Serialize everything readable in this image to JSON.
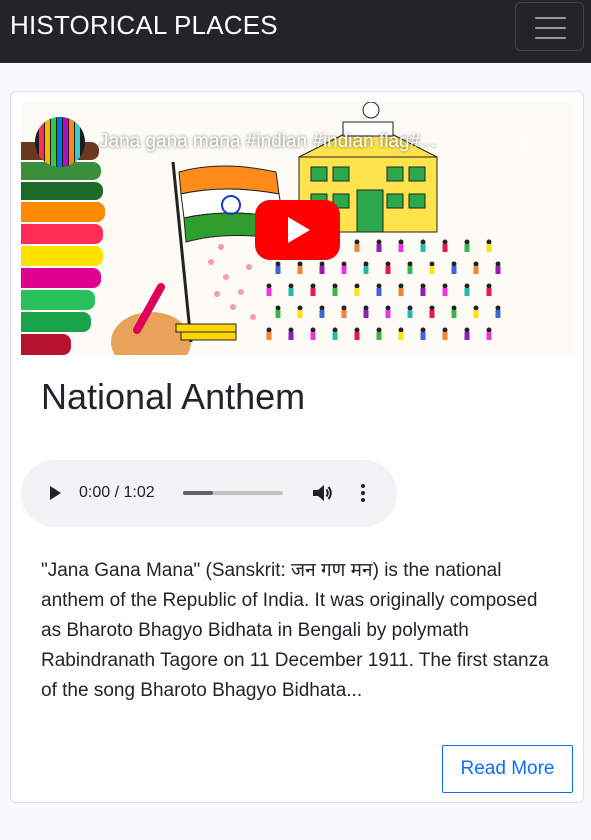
{
  "navbar": {
    "brand": "HISTORICAL PLACES",
    "toggler_icon": "hamburger-menu-icon",
    "background": "#212529"
  },
  "card": {
    "video": {
      "title": "Jana gana mana #indian #indian flag#...",
      "play_icon": "youtube-play-icon",
      "more_icon": "vertical-ellipsis-icon",
      "accent": "#ff0000"
    },
    "title": "National Anthem",
    "audio": {
      "time": "0:00 / 1:02",
      "play_icon": "play-icon",
      "volume_icon": "volume-icon",
      "menu_icon": "vertical-ellipsis-icon",
      "buffered_fraction": 0.3
    },
    "text": "\"Jana Gana Mana\" (Sanskrit: जन गण मन) is the national anthem of the Republic of India. It was originally composed as Bharoto Bhagyo Bidhata in Bengali by polymath Rabindranath Tagore on 11 December 1911. The first stanza of the song Bharoto Bhagyo Bidhata...",
    "read_more": "Read More",
    "accent": "#0d6efd"
  }
}
